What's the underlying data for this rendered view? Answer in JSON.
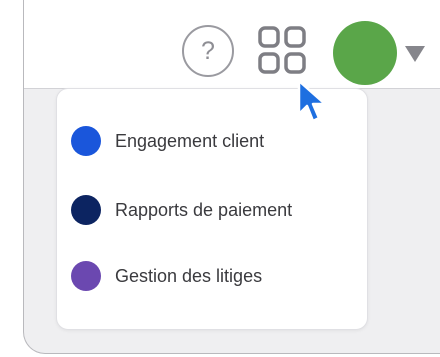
{
  "toolbar": {
    "help_label": "?",
    "help_icon": "question-circle-icon",
    "apps_icon": "grid-apps-icon",
    "avatar_color": "#5aa649",
    "caret_icon": "caret-down-icon"
  },
  "menu": {
    "items": [
      {
        "label": "Engagement client",
        "color": "#1a56db"
      },
      {
        "label": "Rapports de paiement",
        "color": "#0c2461"
      },
      {
        "label": "Gestion des litiges",
        "color": "#6b48b0"
      }
    ]
  },
  "cursor": {
    "icon": "mouse-pointer-icon",
    "color": "#1e6fe0"
  }
}
